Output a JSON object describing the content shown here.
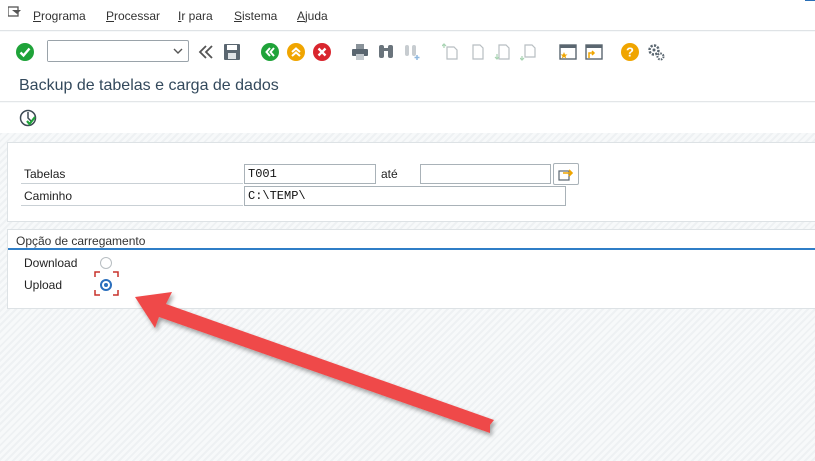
{
  "menubar": {
    "items": [
      {
        "ul": "P",
        "rest": "rograma"
      },
      {
        "ul": "P",
        "rest": "rocessar"
      },
      {
        "ul": "I",
        "rest": "r para"
      },
      {
        "ul": "S",
        "rest": "istema"
      },
      {
        "ul": "A",
        "rest": "juda"
      }
    ]
  },
  "toolbar": {
    "command_value": "",
    "icons": [
      "enter-icon",
      "back-double-icon",
      "save-icon",
      "back-icon",
      "exit-icon",
      "cancel-icon",
      "print-icon",
      "find-icon",
      "find-next-icon",
      "first-page-icon",
      "previous-page-icon",
      "next-page-icon",
      "last-page-icon",
      "create-session-icon",
      "generate-shortcut-icon",
      "help-icon",
      "customize-layout-icon"
    ]
  },
  "header": {
    "title": "Backup de tabelas e carga de dados"
  },
  "selection": {
    "tabelas_label": "Tabelas",
    "tabelas_value": "T001",
    "ate_label": "até",
    "tabelas_to_value": "",
    "caminho_label": "Caminho",
    "caminho_value": "C:\\TEMP\\"
  },
  "options": {
    "title": "Opção de carregamento",
    "download_label": "Download",
    "upload_label": "Upload",
    "selected": "Upload"
  },
  "colors": {
    "accent": "#2f7ec7",
    "arrow": "#ef4a4a",
    "ok_green": "#1fa339",
    "exit_orange": "#f0a500",
    "cancel_red": "#d9262e",
    "help_orange": "#f0a500"
  }
}
